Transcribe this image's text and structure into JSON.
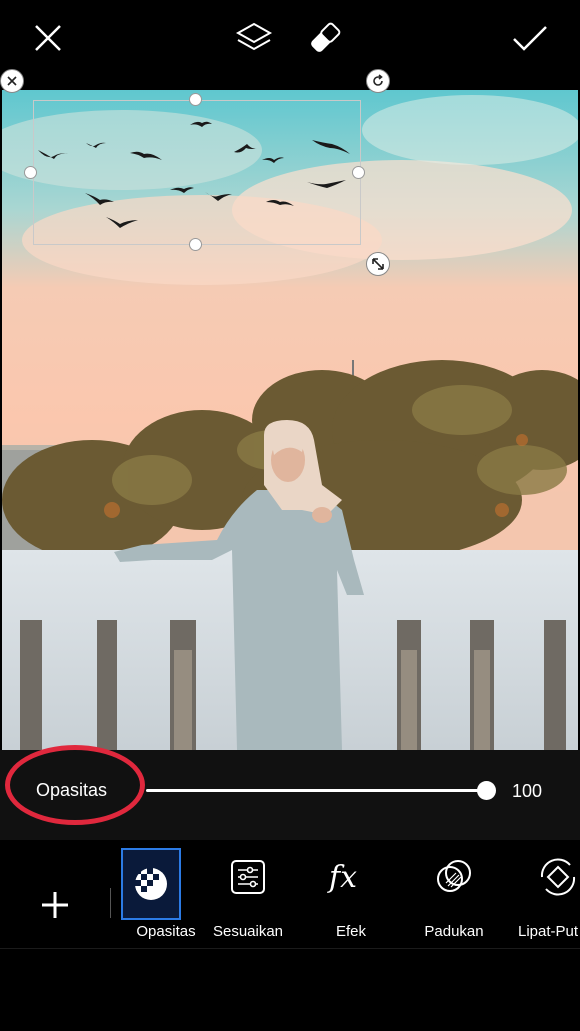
{
  "topbar": {
    "close_icon": "close-icon",
    "layers_icon": "layers-icon",
    "eraser_icon": "eraser-icon",
    "apply_icon": "checkmark-icon"
  },
  "canvas": {
    "photo": "woman in hijab on rooftop with trees and pastel sky",
    "sticker": "flock of birds sticker"
  },
  "opacity": {
    "label": "Opasitas",
    "value": "100",
    "level": 100
  },
  "tools": [
    {
      "label": "Opasitas",
      "icon": "opacity-icon"
    },
    {
      "label": "Sesuaikan",
      "icon": "adjust-icon"
    },
    {
      "label": "Efek",
      "icon": "fx-icon"
    },
    {
      "label": "Padukan",
      "icon": "blend-icon"
    },
    {
      "label": "Lipat-Put",
      "icon": "flip-rotate-icon"
    }
  ],
  "colors": {
    "accent_selected": "#2c7be5",
    "highlight_ring": "#e0283d"
  }
}
